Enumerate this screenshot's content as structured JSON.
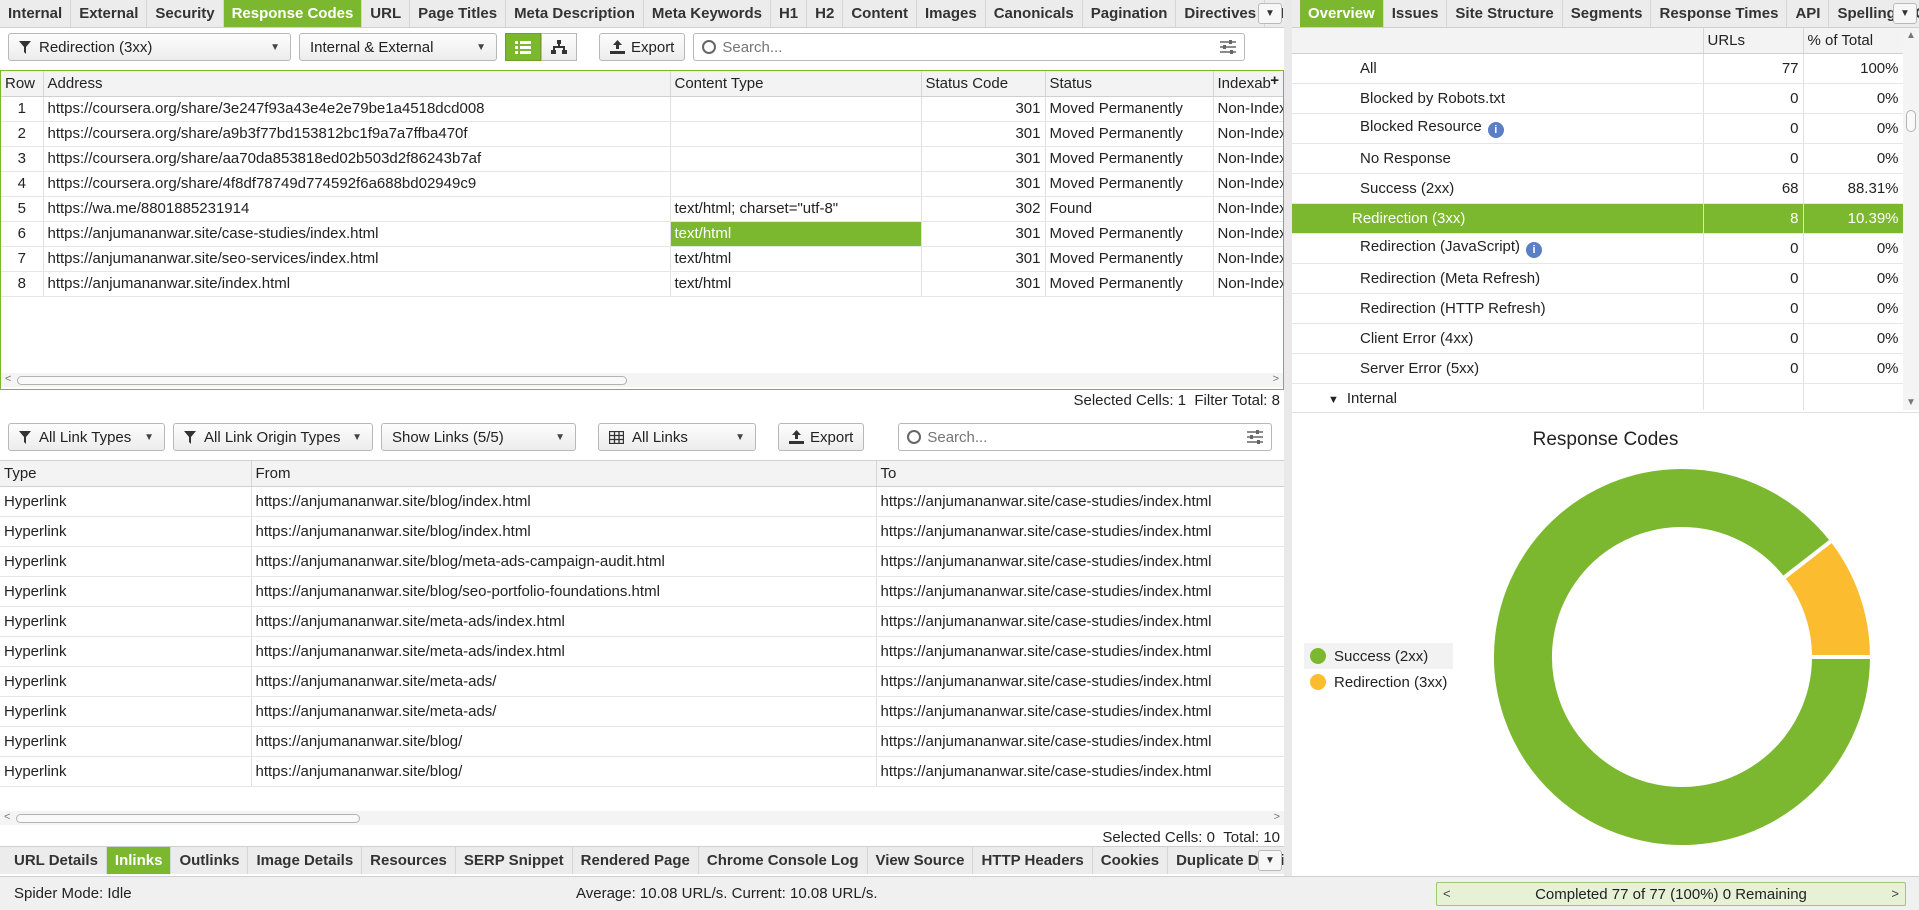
{
  "top_tabs": [
    "Internal",
    "External",
    "Security",
    "Response Codes",
    "URL",
    "Page Titles",
    "Meta Description",
    "Meta Keywords",
    "H1",
    "H2",
    "Content",
    "Images",
    "Canonicals",
    "Pagination",
    "Directives",
    "Hrefl"
  ],
  "top_tabs_active": "Response Codes",
  "toolbar": {
    "filter_value": "Redirection (3xx)",
    "scope_value": "Internal & External",
    "export_label": "Export",
    "search_placeholder": "Search..."
  },
  "main_table": {
    "columns": [
      "Row",
      "Address",
      "Content Type",
      "Status Code",
      "Status",
      "Indexab"
    ],
    "rows": [
      [
        "1",
        "https://coursera.org/share/3e247f93a43e4e2e79be1a4518dcd008",
        "",
        "301",
        "Moved Permanently",
        "Non-Index"
      ],
      [
        "2",
        "https://coursera.org/share/a9b3f77bd153812bc1f9a7a7ffba470f",
        "",
        "301",
        "Moved Permanently",
        "Non-Index"
      ],
      [
        "3",
        "https://coursera.org/share/aa70da853818ed02b503d2f86243b7af",
        "",
        "301",
        "Moved Permanently",
        "Non-Index"
      ],
      [
        "4",
        "https://coursera.org/share/4f8df78749d774592f6a688bd02949c9",
        "",
        "301",
        "Moved Permanently",
        "Non-Index"
      ],
      [
        "5",
        "https://wa.me/8801885231914",
        "text/html; charset=\"utf-8\"",
        "302",
        "Found",
        "Non-Index"
      ],
      [
        "6",
        "https://anjumananwar.site/case-studies/index.html",
        "text/html",
        "301",
        "Moved Permanently",
        "Non-Index"
      ],
      [
        "7",
        "https://anjumananwar.site/seo-services/index.html",
        "text/html",
        "301",
        "Moved Permanently",
        "Non-Index"
      ],
      [
        "8",
        "https://anjumananwar.site/index.html",
        "text/html",
        "301",
        "Moved Permanently",
        "Non-Index"
      ]
    ],
    "add_column_icon": "+"
  },
  "main_status": {
    "selected_cells_label": "Selected Cells:",
    "selected_cells": "1",
    "filter_total_label": "Filter Total:",
    "filter_total": "8"
  },
  "links_toolbar": {
    "link_types": "All Link Types",
    "link_origin": "All Link Origin Types",
    "show_links": "Show Links (5/5)",
    "all_links": "All Links",
    "export_label": "Export",
    "search_placeholder": "Search..."
  },
  "links_table": {
    "columns": [
      "Type",
      "From",
      "To"
    ],
    "rows": [
      [
        "Hyperlink",
        "https://anjumananwar.site/blog/index.html",
        "https://anjumananwar.site/case-studies/index.html"
      ],
      [
        "Hyperlink",
        "https://anjumananwar.site/blog/index.html",
        "https://anjumananwar.site/case-studies/index.html"
      ],
      [
        "Hyperlink",
        "https://anjumananwar.site/blog/meta-ads-campaign-audit.html",
        "https://anjumananwar.site/case-studies/index.html"
      ],
      [
        "Hyperlink",
        "https://anjumananwar.site/blog/seo-portfolio-foundations.html",
        "https://anjumananwar.site/case-studies/index.html"
      ],
      [
        "Hyperlink",
        "https://anjumananwar.site/meta-ads/index.html",
        "https://anjumananwar.site/case-studies/index.html"
      ],
      [
        "Hyperlink",
        "https://anjumananwar.site/meta-ads/index.html",
        "https://anjumananwar.site/case-studies/index.html"
      ],
      [
        "Hyperlink",
        "https://anjumananwar.site/meta-ads/",
        "https://anjumananwar.site/case-studies/index.html"
      ],
      [
        "Hyperlink",
        "https://anjumananwar.site/meta-ads/",
        "https://anjumananwar.site/case-studies/index.html"
      ],
      [
        "Hyperlink",
        "https://anjumananwar.site/blog/",
        "https://anjumananwar.site/case-studies/index.html"
      ],
      [
        "Hyperlink",
        "https://anjumananwar.site/blog/",
        "https://anjumananwar.site/case-studies/index.html"
      ]
    ]
  },
  "links_status": {
    "selected_cells_label": "Selected Cells:",
    "selected_cells": "0",
    "total_label": "Total:",
    "total": "10"
  },
  "bottom_tabs": [
    "URL Details",
    "Inlinks",
    "Outlinks",
    "Image Details",
    "Resources",
    "SERP Snippet",
    "Rendered Page",
    "Chrome Console Log",
    "View Source",
    "HTTP Headers",
    "Cookies",
    "Duplicate Details",
    "S"
  ],
  "bottom_tabs_active": "Inlinks",
  "right_tabs": [
    "Overview",
    "Issues",
    "Site Structure",
    "Segments",
    "Response Times",
    "API",
    "Spelling & G"
  ],
  "right_tabs_active": "Overview",
  "overview": {
    "columns": [
      "",
      "URLs",
      "% of Total"
    ],
    "rows": [
      {
        "label": "All",
        "urls": "77",
        "pct": "100%"
      },
      {
        "label": "Blocked by Robots.txt",
        "urls": "0",
        "pct": "0%"
      },
      {
        "label": "Blocked Resource",
        "urls": "0",
        "pct": "0%",
        "info": "i"
      },
      {
        "label": "No Response",
        "urls": "0",
        "pct": "0%"
      },
      {
        "label": "Success (2xx)",
        "urls": "68",
        "pct": "88.31%"
      },
      {
        "label": "Redirection (3xx)",
        "urls": "8",
        "pct": "10.39%",
        "selected": true
      },
      {
        "label": "Redirection (JavaScript)",
        "urls": "0",
        "pct": "0%",
        "info": "i"
      },
      {
        "label": "Redirection (Meta Refresh)",
        "urls": "0",
        "pct": "0%"
      },
      {
        "label": "Redirection (HTTP Refresh)",
        "urls": "0",
        "pct": "0%"
      },
      {
        "label": "Client Error (4xx)",
        "urls": "0",
        "pct": "0%"
      },
      {
        "label": "Server Error (5xx)",
        "urls": "0",
        "pct": "0%"
      }
    ],
    "group_label": "Internal"
  },
  "chart_data": {
    "type": "pie",
    "title": "Response Codes",
    "categories": [
      "Success (2xx)",
      "Redirection (3xx)"
    ],
    "values": [
      68,
      8
    ],
    "colors": [
      "#7cb82f",
      "#fbbd2f"
    ],
    "legend_placement": "left"
  },
  "footer": {
    "spider_mode": "Spider Mode: Idle",
    "average": "Average: 10.08 URL/s. Current: 10.08 URL/s.",
    "completed": "Completed 77 of 77 (100%) 0 Remaining"
  },
  "colors": {
    "accent": "#7cb82f",
    "secondary": "#fbbd2f"
  }
}
